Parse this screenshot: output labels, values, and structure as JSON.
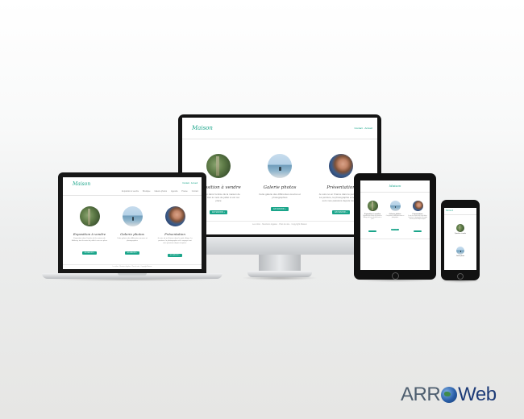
{
  "site": {
    "logo": "Maison",
    "contact": "Contact · Accueil",
    "nav": [
      "Exposition à vendre",
      "Boutique",
      "Galerie photos",
      "Agenda",
      "Presse",
      "Contact"
    ],
    "cards": [
      {
        "title": "Exposition à vendre",
        "text": "Exposition dans l'entrée de la maison de Balleroy, tout le mois de juillet à voir sur place",
        "button": "EN SAVOIR +",
        "image": "forest-path-photo"
      },
      {
        "title": "Galerie photos",
        "text": "Cette galerie des différentes œuvres et photographies",
        "button": "EN SAVOIR +",
        "image": "seaside-photo"
      },
      {
        "title": "Présentation",
        "text": "Je suis né en France dans le petit village. La peinture, la photographie et le voyage sont mes passions depuis toujours.",
        "button": "EN SAVOIR +",
        "image": "portrait-photo"
      }
    ],
    "footer": "Les infos · Mentions légales · Plan du site · Copyright Maison"
  },
  "brand": {
    "part1": "ARR",
    "part2": "Web"
  },
  "colors": {
    "accent": "#1aa58a",
    "brand_dark": "#1e3c78",
    "brand_gray": "#4e5e6f"
  }
}
